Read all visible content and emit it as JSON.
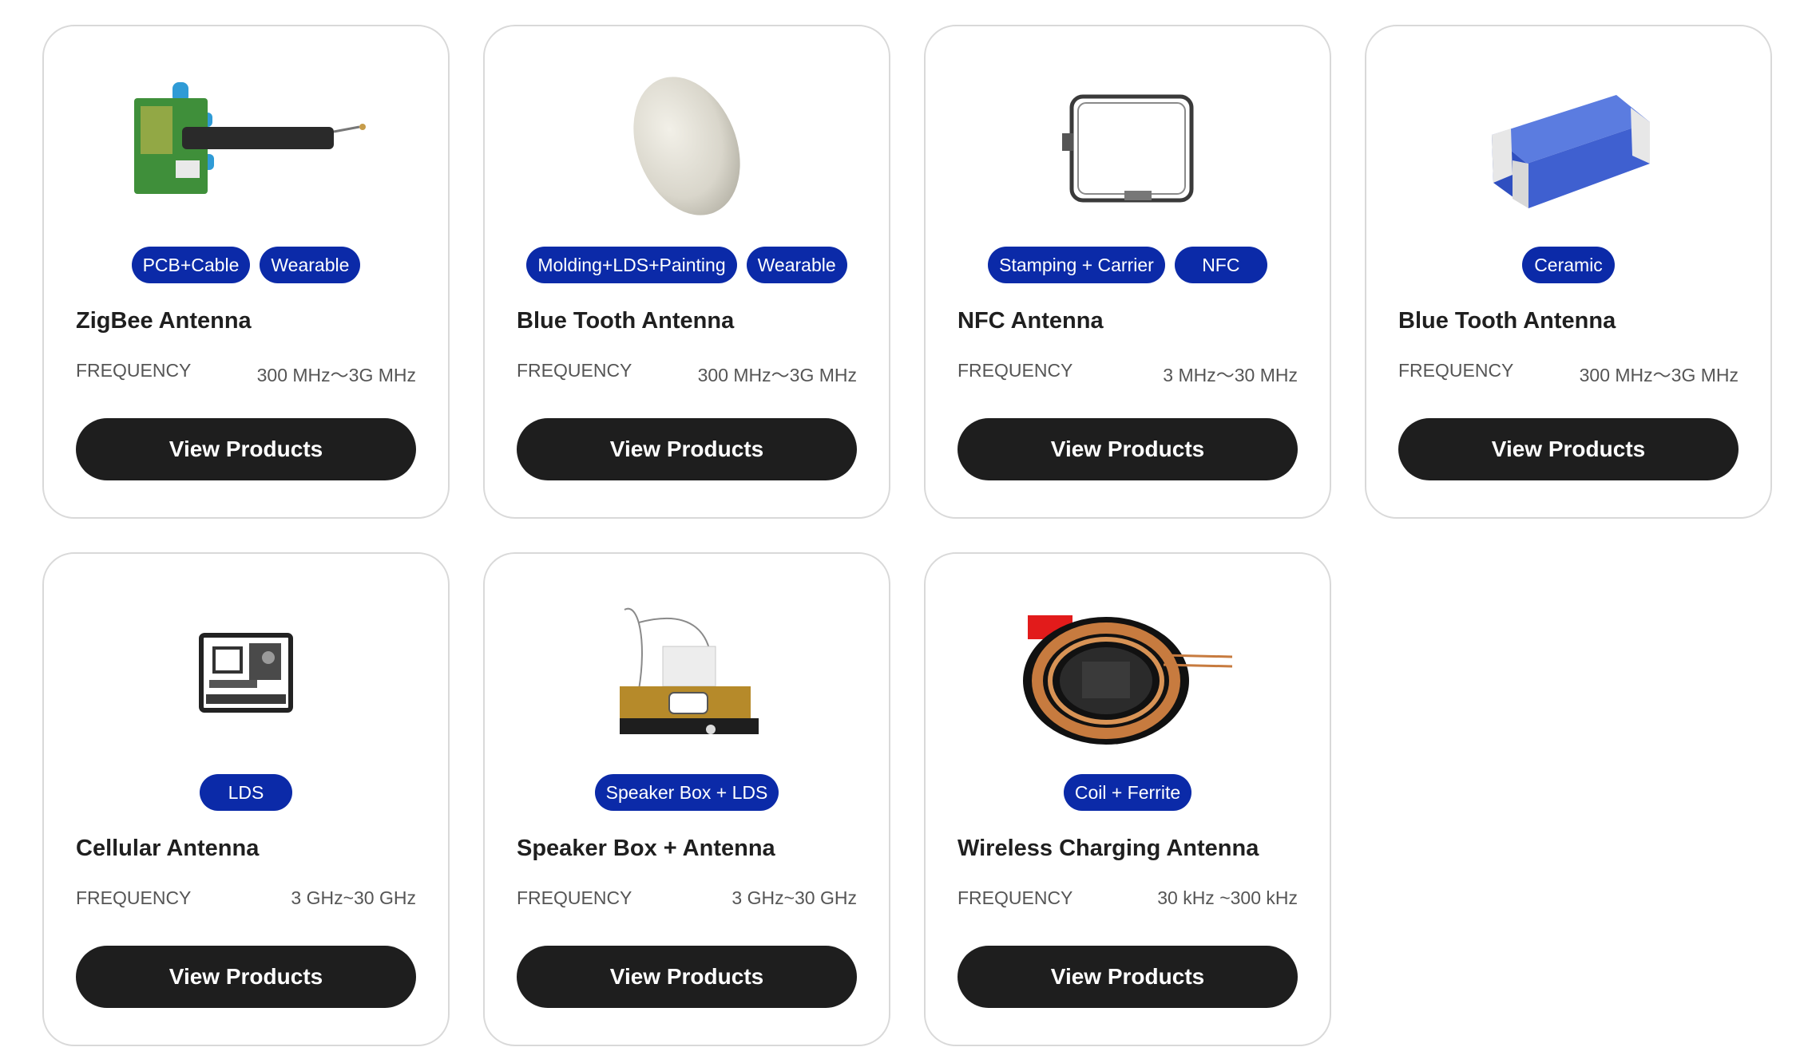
{
  "products": [
    {
      "tags": [
        "PCB+Cable",
        "Wearable"
      ],
      "title": "ZigBee Antenna",
      "frequency_label": "FREQUENCY",
      "frequency_value": "300 MHz～3G MHz",
      "button_label": "View Products",
      "image_icon": "zigbee-antenna-image"
    },
    {
      "tags": [
        "Molding+LDS+Painting",
        "Wearable"
      ],
      "title": "Blue Tooth Antenna",
      "frequency_label": "FREQUENCY",
      "frequency_value": "300 MHz～3G MHz",
      "button_label": "View Products",
      "image_icon": "bluetooth-antenna-molded-image"
    },
    {
      "tags": [
        "Stamping + Carrier",
        "NFC"
      ],
      "title": "NFC Antenna",
      "frequency_label": "FREQUENCY",
      "frequency_value": "3 MHz～30 MHz",
      "button_label": "View Products",
      "image_icon": "nfc-antenna-image"
    },
    {
      "tags": [
        "Ceramic"
      ],
      "title": "Blue Tooth Antenna",
      "frequency_label": "FREQUENCY",
      "frequency_value": "300 MHz～3G MHz",
      "button_label": "View Products",
      "image_icon": "bluetooth-antenna-ceramic-image"
    },
    {
      "tags": [
        "LDS"
      ],
      "title": "Cellular Antenna",
      "frequency_label": "FREQUENCY",
      "frequency_value": "3 GHz~30 GHz",
      "button_label": "View Products",
      "image_icon": "cellular-antenna-image"
    },
    {
      "tags": [
        "Speaker Box + LDS"
      ],
      "title": "Speaker Box + Antenna",
      "frequency_label": "FREQUENCY",
      "frequency_value": "3 GHz~30 GHz",
      "button_label": "View Products",
      "image_icon": "speaker-box-antenna-image"
    },
    {
      "tags": [
        "Coil + Ferrite"
      ],
      "title": "Wireless Charging Antenna",
      "frequency_label": "FREQUENCY",
      "frequency_value": "30 kHz ~300 kHz",
      "button_label": "View Products",
      "image_icon": "wireless-charging-coil-image"
    }
  ],
  "colors": {
    "tag_background": "#0b2aa8",
    "button_background": "#1e1e1e",
    "card_border": "#d9d9d9"
  }
}
